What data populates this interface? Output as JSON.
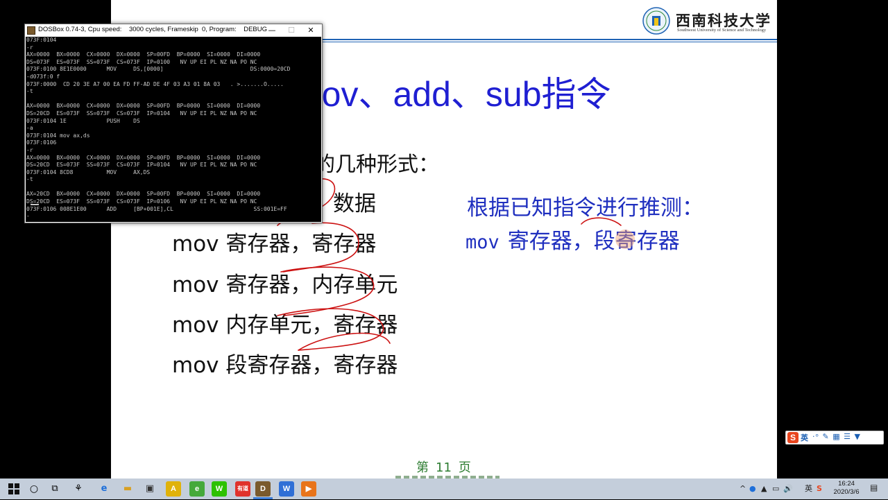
{
  "slide": {
    "logo": {
      "name_cn": "西南科技大学",
      "name_en": "Southwest University of Science and Technology"
    },
    "title": "mov、add、sub指令",
    "forms_heading": "的几种形式：",
    "data_word": "数据",
    "forms": [
      "mov 寄存器，寄存器",
      "mov 寄存器，内存单元",
      "mov 内存单元，寄存器",
      "mov 段寄存器，寄存器"
    ],
    "inference_heading": "根据已知指令进行推测：",
    "inference_mov": "mov",
    "inference_rest": "寄存器，段寄存器",
    "page_prefix": "第",
    "page_number": "11",
    "page_suffix": "页",
    "colors": {
      "title": "#1f1fd2",
      "accent_line": "#1f63b4",
      "inference": "#1f2fbf",
      "ink": "#cc1111",
      "page": "#2e7d32"
    }
  },
  "dosbox": {
    "title": "DOSBox 0.74-3, Cpu speed:    3000 cycles, Frameskip  0, Program:    DEBUG",
    "minimize": "—",
    "maximize": "☐",
    "close": "✕",
    "lines": [
      "073F:0104",
      "-r",
      "AX=0000  BX=0000  CX=0000  DX=0000  SP=00FD  BP=0000  SI=0000  DI=0000",
      "DS=073F  ES=073F  SS=073F  CS=073F  IP=0100   NV UP EI PL NZ NA PO NC",
      "073F:0100 8E1E0000      MOV     DS,[0000]                          DS:0000=20CD",
      "-d073f:0 f",
      "073F:0000  CD 20 3E A7 00 EA FD FF-AD DE 4F 03 A3 01 8A 03   . >.......O.....",
      "-t",
      "",
      "AX=0000  BX=0000  CX=0000  DX=0000  SP=00FD  BP=0000  SI=0000  DI=0000",
      "DS=20CD  ES=073F  SS=073F  CS=073F  IP=0104   NV UP EI PL NZ NA PO NC",
      "073F:0104 1E            PUSH    DS",
      "-a",
      "073F:0104 mov ax,ds",
      "073F:0106",
      "-r",
      "AX=0000  BX=0000  CX=0000  DX=0000  SP=00FD  BP=0000  SI=0000  DI=0000",
      "DS=20CD  ES=073F  SS=073F  CS=073F  IP=0104   NV UP EI PL NZ NA PO NC",
      "073F:0104 8CD8          MOV     AX,DS",
      "-t",
      "",
      "AX=20CD  BX=0000  CX=0000  DX=0000  SP=00FD  BP=0000  SI=0000  DI=0000",
      "DS=20CD  ES=073F  SS=073F  CS=073F  IP=0106   NV UP EI PL NZ NA PO NC",
      "073F:0106 008E1E00      ADD     [BP+001E],CL                        SS:001E=FF",
      "-"
    ]
  },
  "ime": {
    "lang": "英",
    "icons": "·ᵒ  ✎ ▦ ☰ ▼"
  },
  "taskbar": {
    "tray_chevron": "^",
    "tray_lang": "英",
    "volume": "🔊",
    "time": "16:24",
    "date": "2020/3/6",
    "apps": [
      {
        "name": "app-yellow",
        "glyph": "A",
        "color": "#e0b20a"
      },
      {
        "name": "app-360",
        "glyph": "e",
        "color": "#45a93a"
      },
      {
        "name": "app-wechat",
        "glyph": "W",
        "color": "#2dc100"
      },
      {
        "name": "app-youdao",
        "glyph": "有道",
        "color": "#e0322b"
      },
      {
        "name": "app-dosbox",
        "glyph": "D",
        "color": "#7a5a2c"
      },
      {
        "name": "app-wps",
        "glyph": "W",
        "color": "#2f6fd6"
      },
      {
        "name": "app-player",
        "glyph": "▶",
        "color": "#e8741a"
      }
    ]
  }
}
